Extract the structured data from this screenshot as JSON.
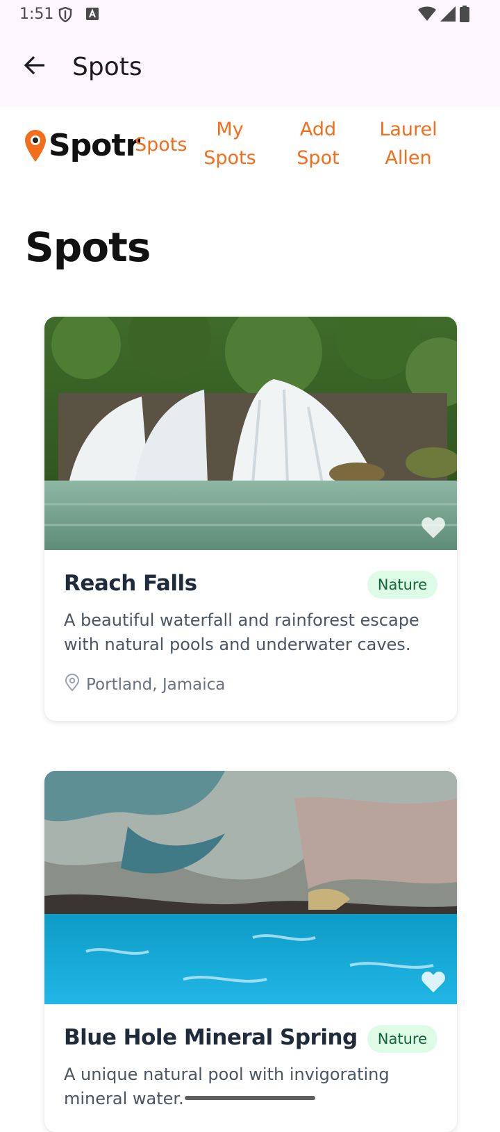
{
  "status": {
    "time": "1:51"
  },
  "appbar": {
    "title": "Spots"
  },
  "site": {
    "logo_text": "Spotr",
    "nav": [
      {
        "lines": [
          "Spots"
        ]
      },
      {
        "lines": [
          "My",
          "Spots"
        ]
      },
      {
        "lines": [
          "Add",
          "Spot"
        ]
      },
      {
        "lines": [
          "Laurel",
          "Allen"
        ]
      }
    ]
  },
  "page": {
    "heading": "Spots"
  },
  "spots": [
    {
      "name": "Reach Falls",
      "category": "Nature",
      "description": "A beautiful waterfall and rainforest escape with natural pools and underwater caves.",
      "location": "Portland, Jamaica"
    },
    {
      "name": "Blue Hole Mineral Spring",
      "category": "Nature",
      "description": "A unique natural pool with invigorating mineral water."
    }
  ],
  "colors": {
    "accent": "#f26e1d",
    "badge_bg": "#dcfce7",
    "badge_text": "#166534"
  },
  "icons": [
    "shield-icon",
    "notification-icon",
    "wifi-icon",
    "signal-icon",
    "battery-icon",
    "back-arrow-icon",
    "location-pin-icon",
    "heart-icon"
  ]
}
